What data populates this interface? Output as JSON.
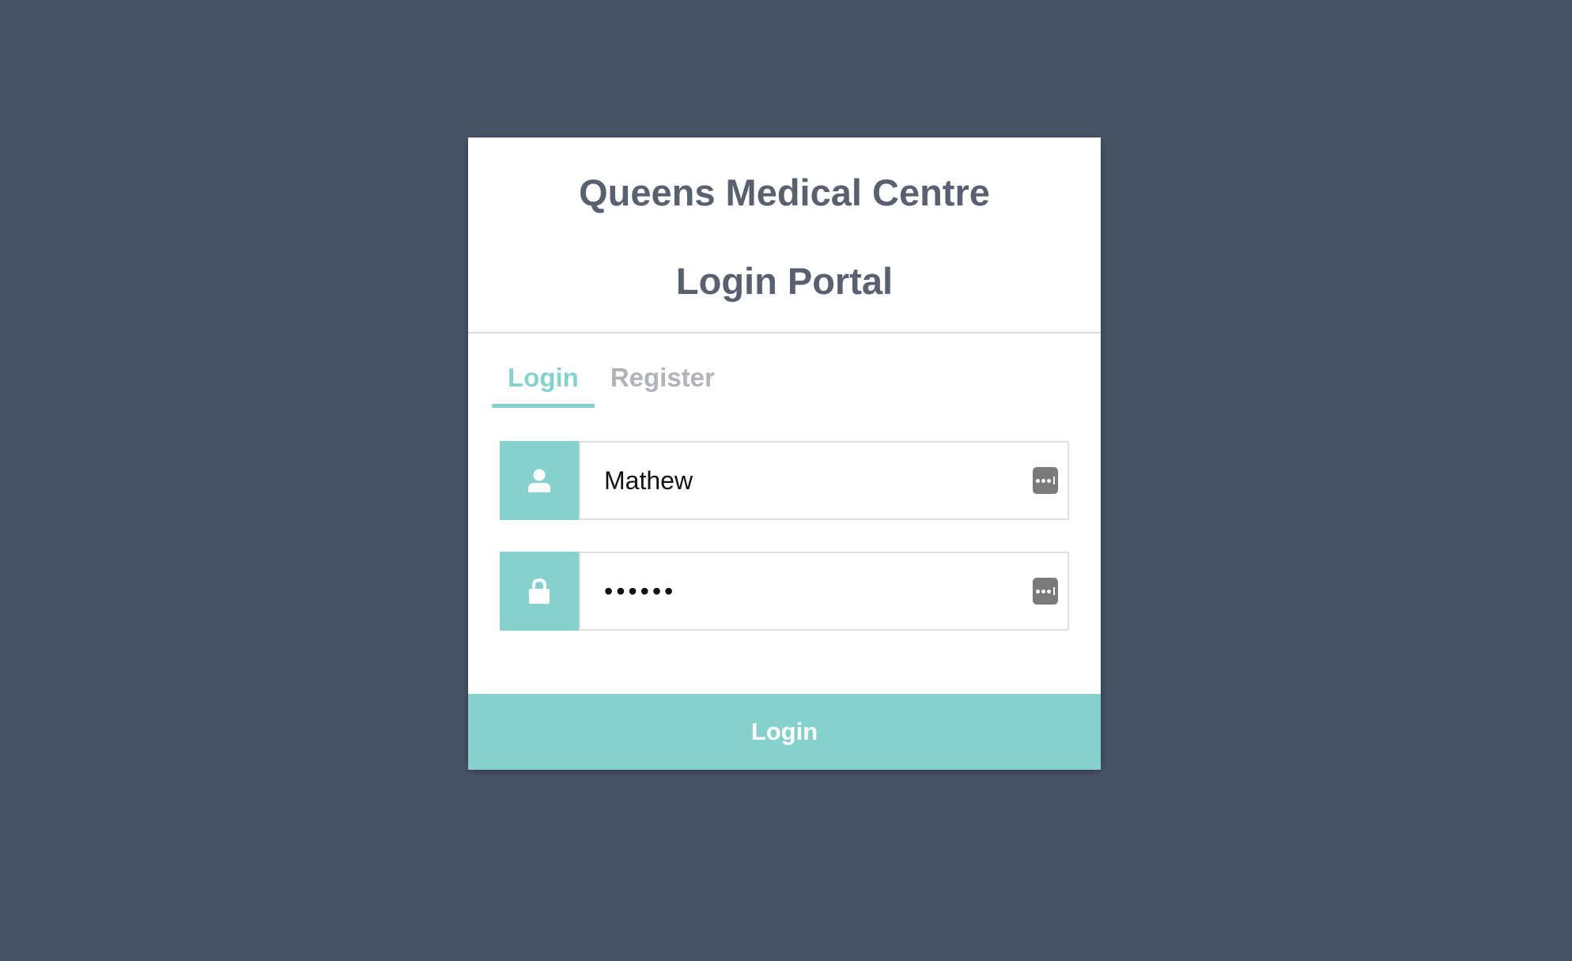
{
  "header": {
    "title_line1": "Queens Medical Centre",
    "title_line2": "Login Portal"
  },
  "tabs": [
    {
      "label": "Login",
      "active": true
    },
    {
      "label": "Register",
      "active": false
    }
  ],
  "form": {
    "username": {
      "value": "Mathew",
      "icon": "user-icon"
    },
    "password": {
      "value": "••••••",
      "icon": "lock-icon"
    },
    "autofill_icon": "password-manager-key-icon"
  },
  "actions": {
    "login_label": "Login"
  },
  "colors": {
    "background": "#475263",
    "accent": "#84d1ce",
    "title_text": "#59606f",
    "inactive_tab": "#b0b3b7"
  }
}
